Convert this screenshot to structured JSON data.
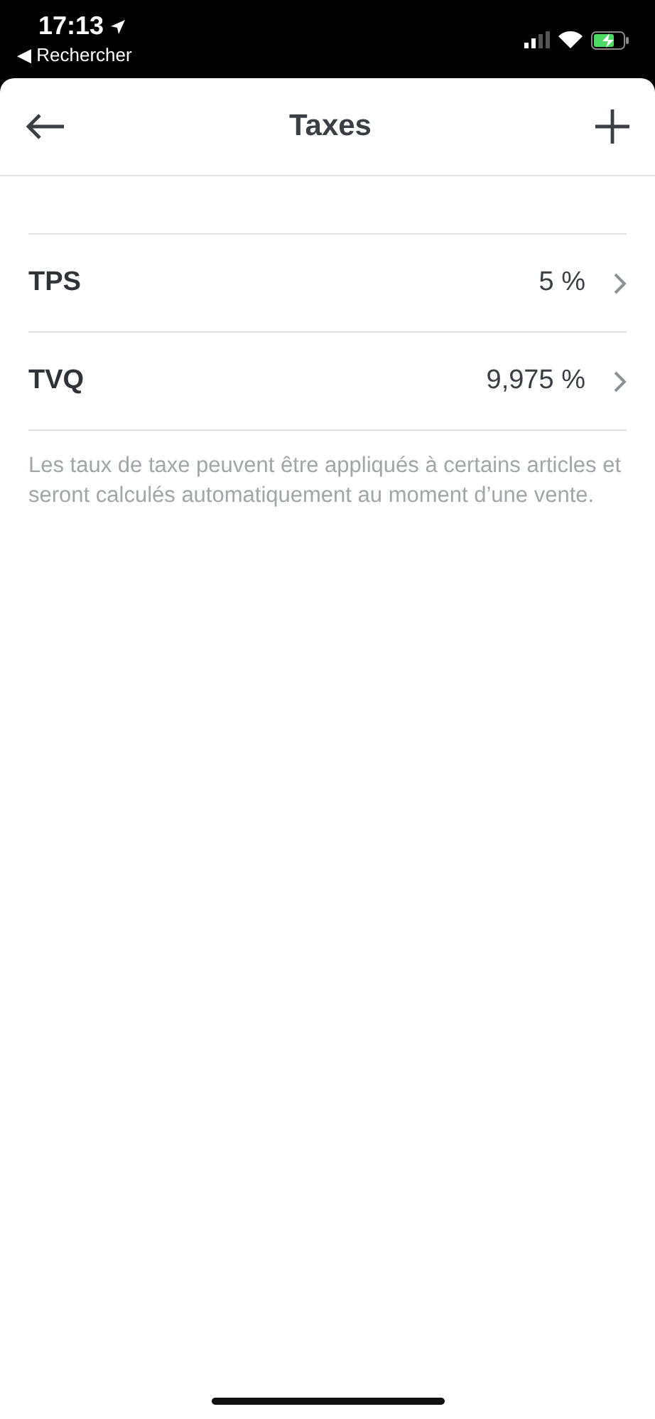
{
  "status_bar": {
    "time": "17:13",
    "back_link": "◀ Rechercher"
  },
  "header": {
    "title": "Taxes"
  },
  "taxes": [
    {
      "name": "TPS",
      "rate": "5 %"
    },
    {
      "name": "TVQ",
      "rate": "9,975 %"
    }
  ],
  "footnote": "Les taux de taxe peuvent être appliqués à certains articles et seront calculés automatiquement au moment d’une vente."
}
